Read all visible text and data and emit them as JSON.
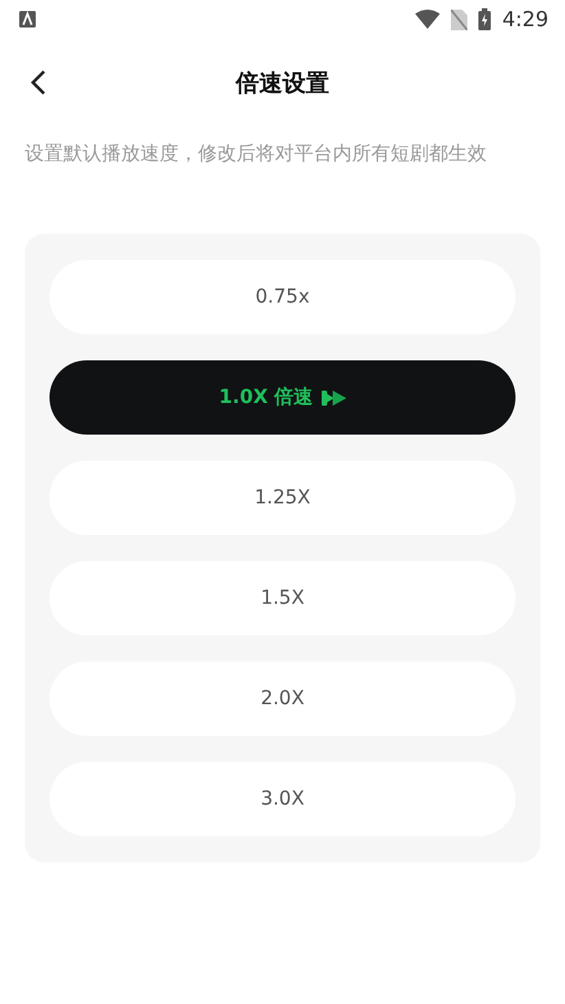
{
  "status_bar": {
    "time": "4:29"
  },
  "header": {
    "title": "倍速设置"
  },
  "description": "设置默认播放速度，修改后将对平台内所有短剧都生效",
  "options": [
    {
      "label": "0.75x",
      "selected": false
    },
    {
      "label": "1.0X 倍速",
      "selected": true
    },
    {
      "label": "1.25X",
      "selected": false
    },
    {
      "label": "1.5X",
      "selected": false
    },
    {
      "label": "2.0X",
      "selected": false
    },
    {
      "label": "3.0X",
      "selected": false
    }
  ]
}
